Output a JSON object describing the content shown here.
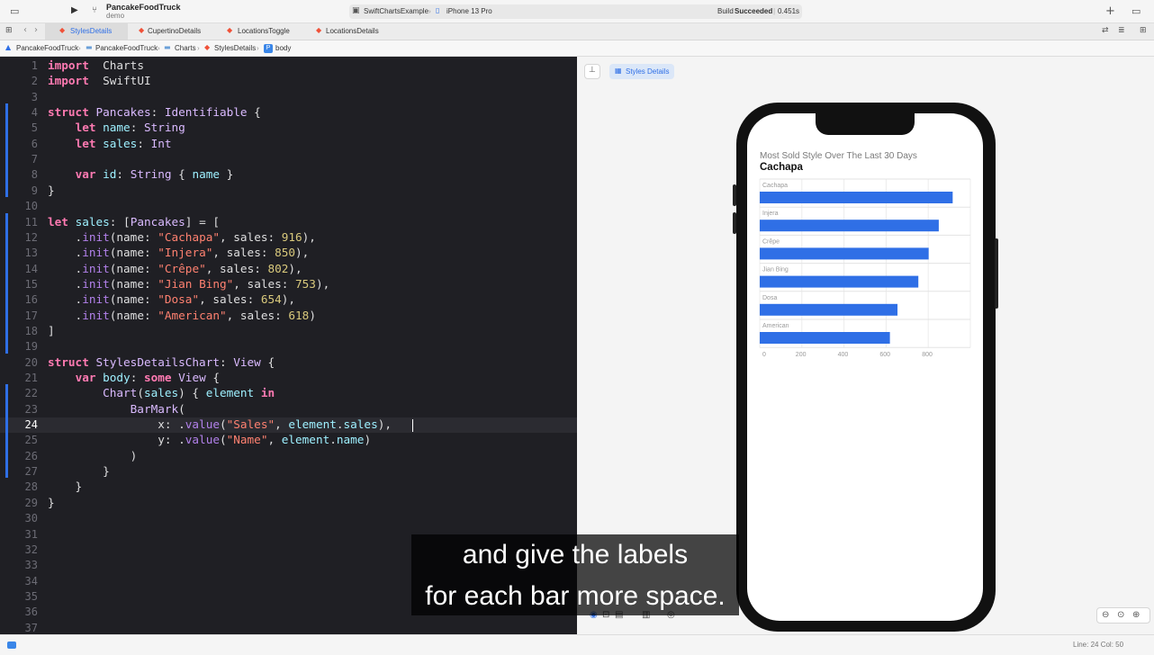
{
  "toolbar": {
    "project_name": "PancakeFoodTruck",
    "branch": "demo",
    "scheme": "SwiftChartsExample",
    "destination": "iPhone 13 Pro",
    "build_status_prefix": "Build",
    "build_status": "Succeeded",
    "build_time": "0.451s"
  },
  "tabs": [
    {
      "label": "StylesDetails",
      "active": true
    },
    {
      "label": "CupertinoDetails",
      "active": false
    },
    {
      "label": "LocationsToggle",
      "active": false
    },
    {
      "label": "LocationsDetails",
      "active": false
    }
  ],
  "breadcrumb": [
    "PancakeFoodTruck",
    "PancakeFoodTruck",
    "Charts",
    "StylesDetails",
    "body"
  ],
  "editor": {
    "current_line": 24,
    "line_numbers": [
      "1",
      "2",
      "3",
      "4",
      "5",
      "6",
      "7",
      "8",
      "9",
      "10",
      "11",
      "12",
      "13",
      "14",
      "15",
      "16",
      "17",
      "18",
      "19",
      "20",
      "21",
      "22",
      "23",
      "24",
      "25",
      "26",
      "27",
      "28",
      "29",
      "30",
      "31",
      "32",
      "33",
      "34",
      "35",
      "36",
      "37"
    ],
    "lines": [
      [
        [
          "kw",
          "import"
        ],
        [
          "",
          "  "
        ],
        [
          "",
          "Charts"
        ]
      ],
      [
        [
          "kw",
          "import"
        ],
        [
          "",
          "  "
        ],
        [
          "",
          "SwiftUI"
        ]
      ],
      [],
      [
        [
          "kw",
          "struct"
        ],
        [
          "",
          " "
        ],
        [
          "ty",
          "Pancakes"
        ],
        [
          "",
          ": "
        ],
        [
          "ty",
          "Identifiable"
        ],
        [
          "",
          " {"
        ]
      ],
      [
        [
          "",
          "    "
        ],
        [
          "kw",
          "let"
        ],
        [
          "",
          " "
        ],
        [
          "prop",
          "name"
        ],
        [
          "",
          ": "
        ],
        [
          "ty",
          "String"
        ]
      ],
      [
        [
          "",
          "    "
        ],
        [
          "kw",
          "let"
        ],
        [
          "",
          " "
        ],
        [
          "prop",
          "sales"
        ],
        [
          "",
          ": "
        ],
        [
          "ty",
          "Int"
        ]
      ],
      [],
      [
        [
          "",
          "    "
        ],
        [
          "kw",
          "var"
        ],
        [
          "",
          " "
        ],
        [
          "prop",
          "id"
        ],
        [
          "",
          ": "
        ],
        [
          "ty",
          "String"
        ],
        [
          "",
          " { "
        ],
        [
          "prop",
          "name"
        ],
        [
          "",
          " }"
        ]
      ],
      [
        [
          "",
          "}"
        ]
      ],
      [],
      [
        [
          "kw",
          "let"
        ],
        [
          "",
          " "
        ],
        [
          "prop",
          "sales"
        ],
        [
          "",
          ": ["
        ],
        [
          "ty",
          "Pancakes"
        ],
        [
          "",
          "] = ["
        ]
      ],
      [
        [
          "",
          "    ."
        ],
        [
          "fn",
          "init"
        ],
        [
          "",
          "(name: "
        ],
        [
          "str",
          "\"Cachapa\""
        ],
        [
          "",
          ", sales: "
        ],
        [
          "num",
          "916"
        ],
        [
          "",
          "),"
        ]
      ],
      [
        [
          "",
          "    ."
        ],
        [
          "fn",
          "init"
        ],
        [
          "",
          "(name: "
        ],
        [
          "str",
          "\"Injera\""
        ],
        [
          "",
          ", sales: "
        ],
        [
          "num",
          "850"
        ],
        [
          "",
          "),"
        ]
      ],
      [
        [
          "",
          "    ."
        ],
        [
          "fn",
          "init"
        ],
        [
          "",
          "(name: "
        ],
        [
          "str",
          "\"Crêpe\""
        ],
        [
          "",
          ", sales: "
        ],
        [
          "num",
          "802"
        ],
        [
          "",
          "),"
        ]
      ],
      [
        [
          "",
          "    ."
        ],
        [
          "fn",
          "init"
        ],
        [
          "",
          "(name: "
        ],
        [
          "str",
          "\"Jian Bing\""
        ],
        [
          "",
          ", sales: "
        ],
        [
          "num",
          "753"
        ],
        [
          "",
          "),"
        ]
      ],
      [
        [
          "",
          "    ."
        ],
        [
          "fn",
          "init"
        ],
        [
          "",
          "(name: "
        ],
        [
          "str",
          "\"Dosa\""
        ],
        [
          "",
          ", sales: "
        ],
        [
          "num",
          "654"
        ],
        [
          "",
          "),"
        ]
      ],
      [
        [
          "",
          "    ."
        ],
        [
          "fn",
          "init"
        ],
        [
          "",
          "(name: "
        ],
        [
          "str",
          "\"American\""
        ],
        [
          "",
          ", sales: "
        ],
        [
          "num",
          "618"
        ],
        [
          "",
          ")"
        ]
      ],
      [
        [
          "",
          "]"
        ]
      ],
      [],
      [
        [
          "kw",
          "struct"
        ],
        [
          "",
          " "
        ],
        [
          "ty",
          "StylesDetailsChart"
        ],
        [
          "",
          ": "
        ],
        [
          "ty",
          "View"
        ],
        [
          "",
          " {"
        ]
      ],
      [
        [
          "",
          "    "
        ],
        [
          "kw",
          "var"
        ],
        [
          "",
          " "
        ],
        [
          "prop",
          "body"
        ],
        [
          "",
          ": "
        ],
        [
          "kw",
          "some"
        ],
        [
          "",
          " "
        ],
        [
          "ty",
          "View"
        ],
        [
          "",
          " {"
        ]
      ],
      [
        [
          "",
          "        "
        ],
        [
          "ty",
          "Chart"
        ],
        [
          "",
          "("
        ],
        [
          "prop",
          "sales"
        ],
        [
          "",
          ") { "
        ],
        [
          "prop",
          "element"
        ],
        [
          "",
          " "
        ],
        [
          "kw",
          "in"
        ]
      ],
      [
        [
          "",
          "            "
        ],
        [
          "ty",
          "BarMark"
        ],
        [
          "",
          "("
        ]
      ],
      [
        [
          "",
          "                x: ."
        ],
        [
          "fn",
          "value"
        ],
        [
          "",
          "("
        ],
        [
          "str",
          "\"Sales\""
        ],
        [
          "",
          ", "
        ],
        [
          "prop",
          "element"
        ],
        [
          "",
          "."
        ],
        [
          "prop",
          "sales"
        ],
        [
          "",
          "),"
        ]
      ],
      [
        [
          "",
          "                y: ."
        ],
        [
          "fn",
          "value"
        ],
        [
          "",
          "("
        ],
        [
          "str",
          "\"Name\""
        ],
        [
          "",
          ", "
        ],
        [
          "prop",
          "element"
        ],
        [
          "",
          "."
        ],
        [
          "prop",
          "name"
        ],
        [
          "",
          ")"
        ]
      ],
      [
        [
          "",
          "            )"
        ]
      ],
      [
        [
          "",
          "        }"
        ]
      ],
      [
        [
          "",
          "    }"
        ]
      ],
      [
        [
          "",
          "}"
        ]
      ],
      [],
      [],
      [],
      [],
      [],
      [],
      [],
      []
    ]
  },
  "canvas": {
    "preview_tab_label": "Styles Details"
  },
  "chart_data": {
    "type": "bar",
    "orientation": "horizontal",
    "subtitle": "Most Sold Style Over The Last 30 Days",
    "title": "Cachapa",
    "categories": [
      "Cachapa",
      "Injera",
      "Crêpe",
      "Jian Bing",
      "Dosa",
      "American"
    ],
    "values": [
      916,
      850,
      802,
      753,
      654,
      618
    ],
    "xticks": [
      "0",
      "200",
      "400",
      "600",
      "800"
    ],
    "xlim": [
      0,
      1000
    ],
    "bar_color": "#2f6fe6",
    "grid": true
  },
  "caption": {
    "line1": "and give the labels",
    "line2": "for each bar more space."
  },
  "statusbar": {
    "position": "Line: 24  Col: 50"
  },
  "colors": {
    "editor_bg": "#1f1f24",
    "accent": "#2f6fe6"
  }
}
